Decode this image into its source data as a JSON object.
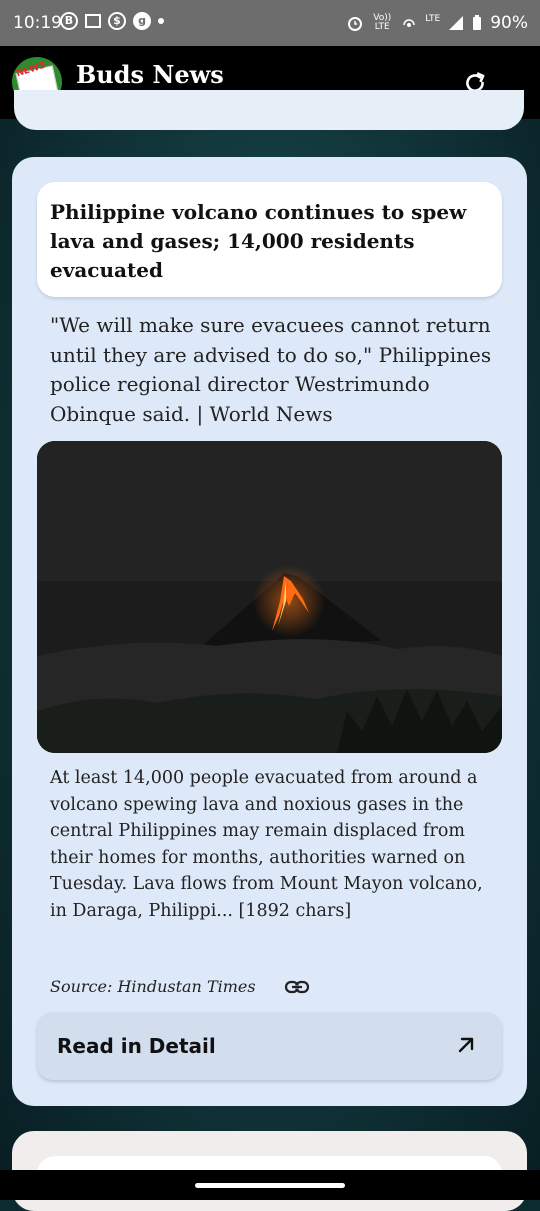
{
  "status_bar": {
    "time": "10:19",
    "notification_icons": [
      "b-circle-icon",
      "message-icon",
      "currency-icon",
      "g-circle-icon",
      "dot-icon"
    ],
    "volte_label": "Vo)) LTE",
    "lte_label": "LTE",
    "battery": "90%"
  },
  "app_bar": {
    "logo_text": "NEWS",
    "title": "Buds News",
    "refresh_icon": "refresh-icon"
  },
  "article": {
    "headline": "Philippine volcano continues to spew lava and gases; 14,000 residents evacuated",
    "quote": "\"We will make sure evacuees cannot return until they are advised to do so,\" Philippines police regional director Westrimundo Obinque said. | World News",
    "image_alt": "Volcano erupting lava at night",
    "body": "At least 14,000 people evacuated from around a volcano spewing lava and noxious gases in the central Philippines may remain displaced from their homes for months, authorities warned on Tuesday. Lava flows from Mount Mayon volcano, in Daraga, Philippi... [1892 chars]",
    "source": "Source: Hindustan Times",
    "link_icon": "link-icon",
    "read_button": "Read in Detail",
    "arrow_icon": "arrow-up-right-icon"
  },
  "colors": {
    "card_bg": "#dde8f8",
    "button_bg": "#d2deee",
    "app_bar_bg": "#000000"
  }
}
